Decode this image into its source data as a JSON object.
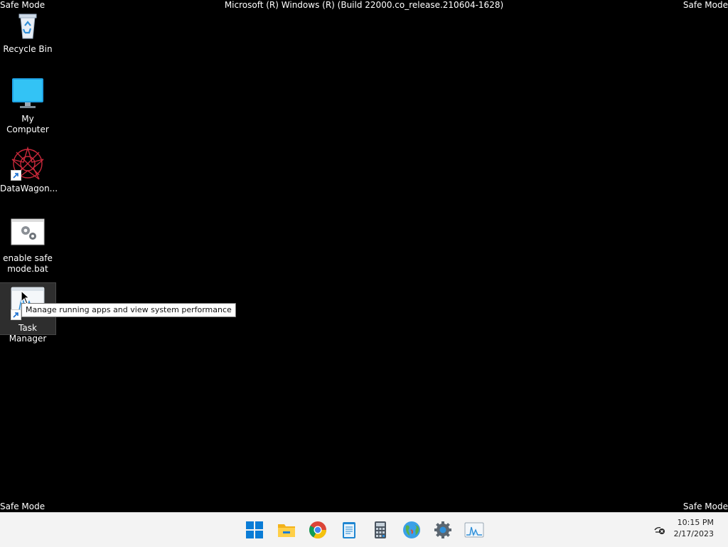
{
  "top_bar": {
    "left_label": "Safe Mode",
    "title": "Microsoft (R) Windows (R) (Build 22000.co_release.210604-1628)",
    "right_label": "Safe Mode"
  },
  "bottom_bar": {
    "left_label": "Safe Mode",
    "right_label": "Safe Mode"
  },
  "desktop": {
    "icons": [
      {
        "label": "Recycle Bin",
        "icon": "recycle-bin-icon"
      },
      {
        "label": "My Computer",
        "icon": "monitor-icon"
      },
      {
        "label": "DataWagon...",
        "icon": "datawagon-logo-icon",
        "shortcut": true
      },
      {
        "label": "enable safe mode.bat",
        "icon": "batch-file-gear-icon"
      },
      {
        "label": "Task Manager",
        "icon": "task-manager-icon",
        "shortcut": true,
        "selected": true
      }
    ],
    "tooltip": "Manage running apps and view system performance"
  },
  "taskbar": {
    "apps": [
      {
        "name": "Start",
        "icon": "windows-start-icon"
      },
      {
        "name": "File Explorer",
        "icon": "folder-icon"
      },
      {
        "name": "Google Chrome",
        "icon": "chrome-icon"
      },
      {
        "name": "Notepad",
        "icon": "notepad-icon"
      },
      {
        "name": "Calculator",
        "icon": "calculator-icon"
      },
      {
        "name": "Globe",
        "icon": "globe-icon"
      },
      {
        "name": "Settings",
        "icon": "settings-gear-icon"
      },
      {
        "name": "Task Manager",
        "icon": "task-manager-icon"
      }
    ],
    "tray_icon": "network-disconnected-icon",
    "time": "10:15 PM",
    "date": "2/17/2023"
  },
  "colors": {
    "desktop_bg": "#000000",
    "taskbar_bg": "#f3f3f3",
    "windows_blue": "#0a7cd6"
  }
}
